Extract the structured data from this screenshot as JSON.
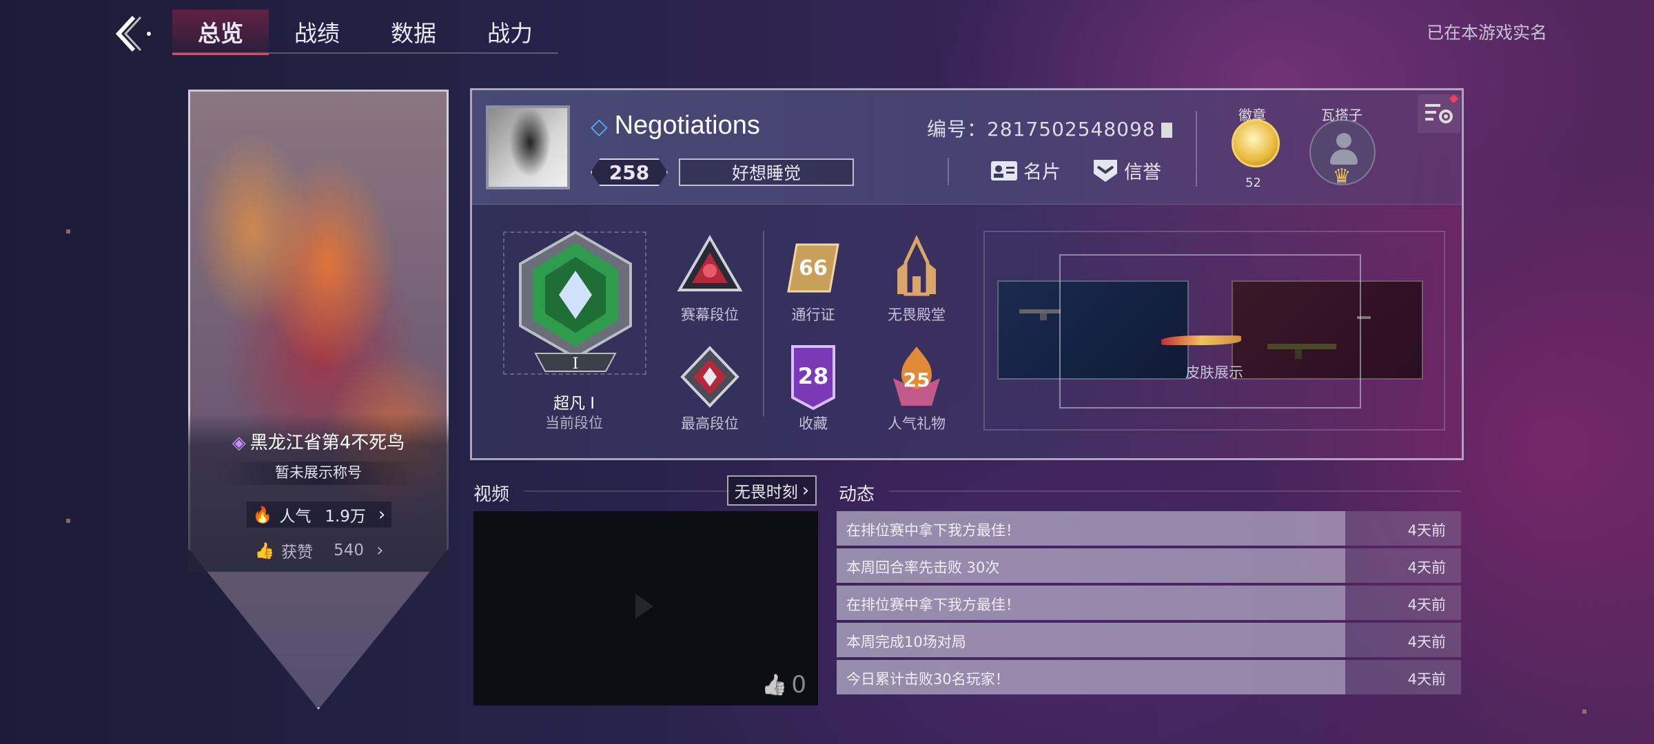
{
  "nav": {
    "tabs": [
      {
        "label": "总览",
        "active": true
      },
      {
        "label": "战绩",
        "active": false
      },
      {
        "label": "数据",
        "active": false
      },
      {
        "label": "战力",
        "active": false
      }
    ],
    "realname_status": "已在本游戏实名"
  },
  "banner": {
    "player_title": "黑龙江省第4不死鸟",
    "display_title": "暂未展示称号",
    "popularity_label": "人气",
    "popularity_value": "1.9万",
    "likes_label": "获赞",
    "likes_value": "540"
  },
  "profile": {
    "username": "Negotiations",
    "level": "258",
    "signature": "好想睡觉",
    "uid_label": "编号：",
    "uid": "2817502548098",
    "card_label": "名片",
    "credit_label": "信誉",
    "badge_label": "徽章",
    "badge_count": "52",
    "buddy_label": "瓦搭子"
  },
  "rank": {
    "current_name": "超凡 I",
    "current_label": "当前段位",
    "rank_numeral": "I"
  },
  "stats": {
    "act_rank_label": "赛幕段位",
    "peak_rank_label": "最高段位",
    "battlepass_value": "66",
    "battlepass_label": "通行证",
    "hall_label": "无畏殿堂",
    "collection_value": "28",
    "collection_label": "收藏",
    "gift_value": "25",
    "gift_label": "人气礼物"
  },
  "skins": {
    "label": "皮肤展示"
  },
  "video": {
    "title": "视频",
    "moments_label": "无畏时刻",
    "likes": "0"
  },
  "activity": {
    "title": "动态",
    "items": [
      {
        "text": "在排位赛中拿下我方最佳！",
        "time": "4天前"
      },
      {
        "text": "本周回合率先击败 30次",
        "time": "4天前"
      },
      {
        "text": "在排位赛中拿下我方最佳！",
        "time": "4天前"
      },
      {
        "text": "本周完成10场对局",
        "time": "4天前"
      },
      {
        "text": "今日累计击败30名玩家！",
        "time": "4天前"
      }
    ]
  },
  "colors": {
    "accent": "#ff3a55",
    "rank_green": "#2f9b4c",
    "gold": "#e8b93a"
  }
}
